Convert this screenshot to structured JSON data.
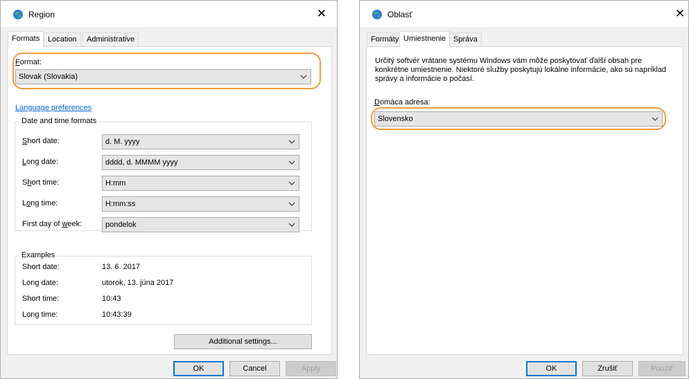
{
  "left": {
    "title": "Region",
    "tabs": [
      "Formats",
      "Location",
      "Administrative"
    ],
    "format_label": "Format:",
    "format_value": "Slovak (Slovakia)",
    "language_link": "Language preferences",
    "date_time_group": "Date and time formats",
    "rows": [
      {
        "label": "Short date:",
        "value": "d. M. yyyy"
      },
      {
        "label": "Long date:",
        "value": "dddd, d. MMMM yyyy"
      },
      {
        "label": "Short time:",
        "value": "H:mm"
      },
      {
        "label": "Long time:",
        "value": "H:mm:ss"
      },
      {
        "label": "First day of week:",
        "value": "pondelok"
      }
    ],
    "examples_group": "Examples",
    "examples": [
      {
        "label": "Short date:",
        "value": "13. 6. 2017"
      },
      {
        "label": "Long date:",
        "value": "utorok, 13. júna 2017"
      },
      {
        "label": "Short time:",
        "value": "10:43"
      },
      {
        "label": "Long time:",
        "value": "10:43:39"
      }
    ],
    "additional_settings": "Additional settings...",
    "ok": "OK",
    "cancel": "Cancel",
    "apply": "Apply"
  },
  "right": {
    "title": "Oblasť",
    "tabs": [
      "Formáty",
      "Umiestnenie",
      "Správa"
    ],
    "description": "Určitý softvér vrátane systému Windows vám môže poskytovať ďalší obsah pre konkrétne umiestnenie. Niektoré služby poskytujú lokálne informácie, ako sú napríklad správy a informácie o počasí.",
    "home_label": "Domáca adresa:",
    "home_value": "Slovensko",
    "ok": "OK",
    "cancel": "Zrušiť",
    "apply": "Použiť"
  },
  "icons": {
    "app": "globe-icon",
    "close": "close-icon",
    "dropdown": "chevron-down-icon"
  },
  "colors": {
    "highlight": "#f39a3b",
    "link": "#0066cc",
    "default_button_border": "#0078d7"
  }
}
